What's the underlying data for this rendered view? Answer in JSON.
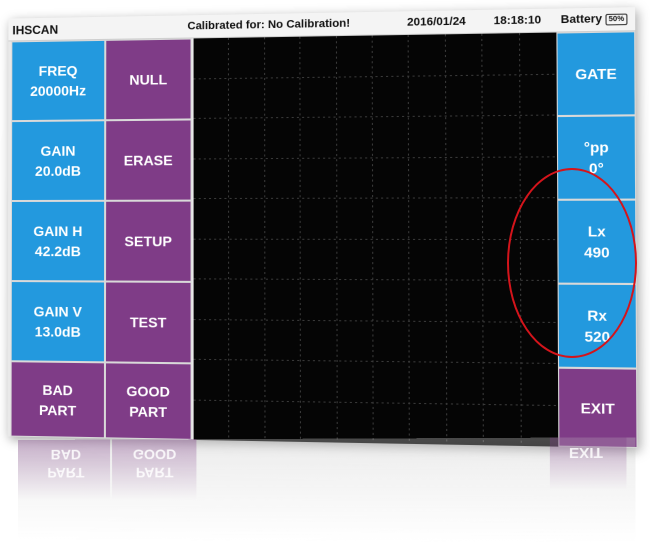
{
  "status": {
    "app_name": "IHSCAN",
    "calibration": "Calibrated for: No Calibration!",
    "date": "2016/01/24",
    "time": "18:18:10",
    "battery_label": "Battery",
    "battery_level": "50%"
  },
  "left_column": [
    {
      "label": "FREQ",
      "value": "20000Hz"
    },
    {
      "label": "GAIN",
      "value": "20.0dB"
    },
    {
      "label": "GAIN H",
      "value": "42.2dB"
    },
    {
      "label": "GAIN V",
      "value": "13.0dB"
    },
    {
      "label": "BAD",
      "value": "PART"
    }
  ],
  "middle_column": [
    {
      "label": "NULL"
    },
    {
      "label": "ERASE"
    },
    {
      "label": "SETUP"
    },
    {
      "label": "TEST"
    },
    {
      "label": "GOOD",
      "value": "PART"
    }
  ],
  "right_column": [
    {
      "label": "GATE"
    },
    {
      "label": "°pp",
      "value": "0°"
    },
    {
      "label": "Lx",
      "value": "490"
    },
    {
      "label": "Rx",
      "value": "520"
    },
    {
      "label": "EXIT"
    }
  ],
  "colors": {
    "button_blue": "#2399de",
    "button_purple": "#7f3c87",
    "screen": "#050505",
    "annotation_circle": "#d4141b"
  }
}
